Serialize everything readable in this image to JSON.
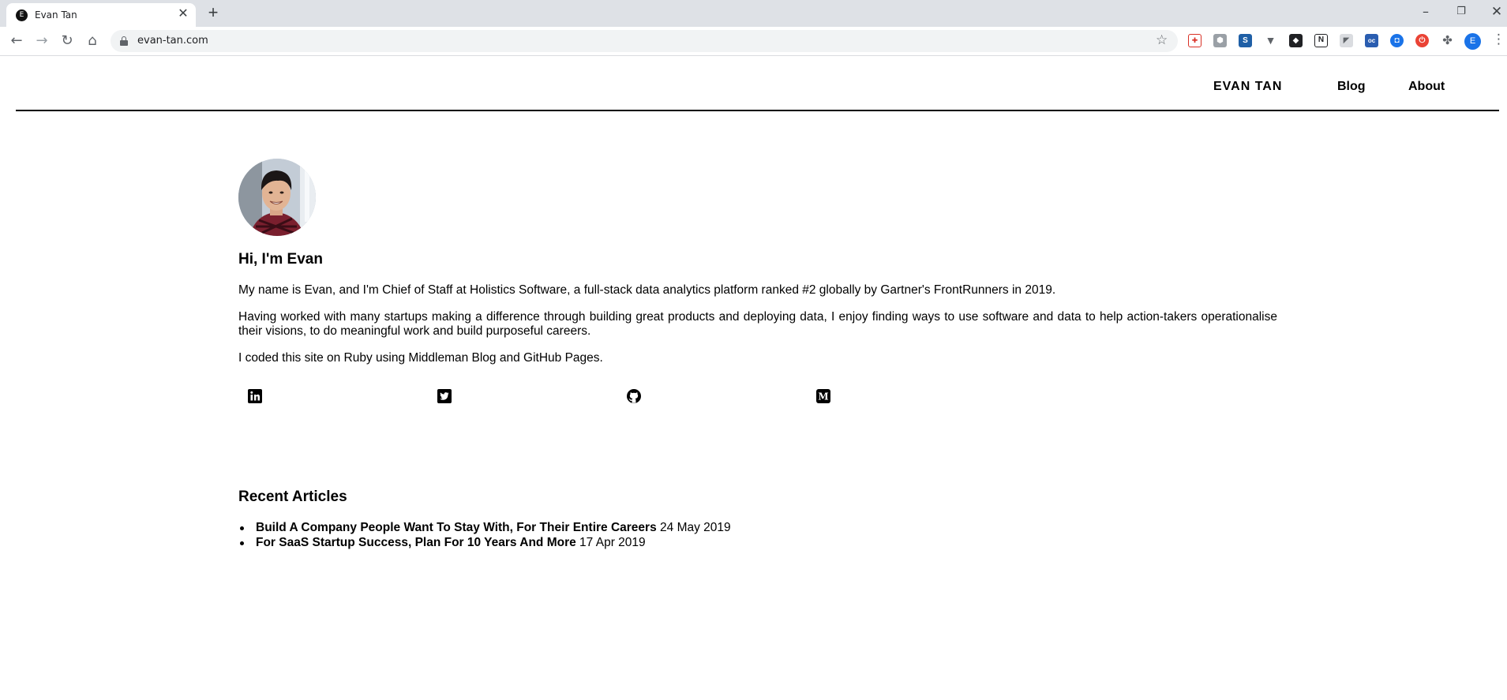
{
  "browser": {
    "tab_title": "Evan Tan",
    "tab_favicon": "E",
    "url": "evan-tan.com",
    "profile_initial": "E"
  },
  "site": {
    "brand": "EVAN TAN",
    "nav": {
      "blog": "Blog",
      "about": "About"
    }
  },
  "intro": {
    "heading": "Hi, I'm Evan",
    "paragraph1": "My name is Evan, and I'm Chief of Staff at Holistics Software, a full-stack data analytics platform ranked #2 globally by Gartner's FrontRunners in 2019.",
    "paragraph2": "Having worked with many startups making a difference through building great products and deploying data, I enjoy finding ways to use software and data to help action-takers operationalise their visions, to do meaningful work and build purposeful careers.",
    "paragraph3": "I coded this site on Ruby using Middleman Blog and GitHub Pages."
  },
  "social_icons": [
    "linkedin-icon",
    "twitter-icon",
    "github-icon",
    "medium-icon"
  ],
  "recent": {
    "heading": "Recent Articles",
    "articles": [
      {
        "title": "Build A Company People Want To Stay With, For Their Entire Careers",
        "date": "24 May 2019"
      },
      {
        "title": "For SaaS Startup Success, Plan For 10 Years And More",
        "date": "17 Apr 2019"
      }
    ]
  }
}
